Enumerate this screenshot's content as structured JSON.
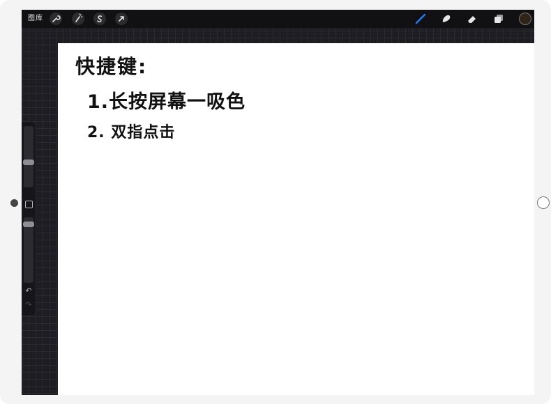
{
  "toolbar": {
    "gallery_label": "图库",
    "left_tools": [
      {
        "name": "actions",
        "icon": "wrench-icon",
        "glyph": "🔧"
      },
      {
        "name": "adjustments",
        "icon": "magic-wand-icon",
        "glyph": "✎"
      },
      {
        "name": "selection",
        "icon": "selection-s-icon",
        "glyph": "S"
      },
      {
        "name": "transform",
        "icon": "arrow-cursor-icon",
        "glyph": "➚"
      }
    ],
    "right_tools": [
      {
        "name": "brush",
        "icon": "brush-icon",
        "active": true
      },
      {
        "name": "smudge",
        "icon": "smudge-icon",
        "active": false
      },
      {
        "name": "eraser",
        "icon": "eraser-icon",
        "active": false
      },
      {
        "name": "layers",
        "icon": "layers-icon",
        "active": false
      }
    ],
    "current_color": "#2f2418",
    "active_tool_color": "#1e7bff"
  },
  "sidebar": {
    "brush_size_level": 0.35,
    "opacity_level": 0.15,
    "undo_glyph": "↶",
    "redo_glyph": "↷"
  },
  "canvas": {
    "lines": [
      "快捷键:",
      "1.长按屏幕一吸色",
      "2. 双指点击"
    ]
  }
}
